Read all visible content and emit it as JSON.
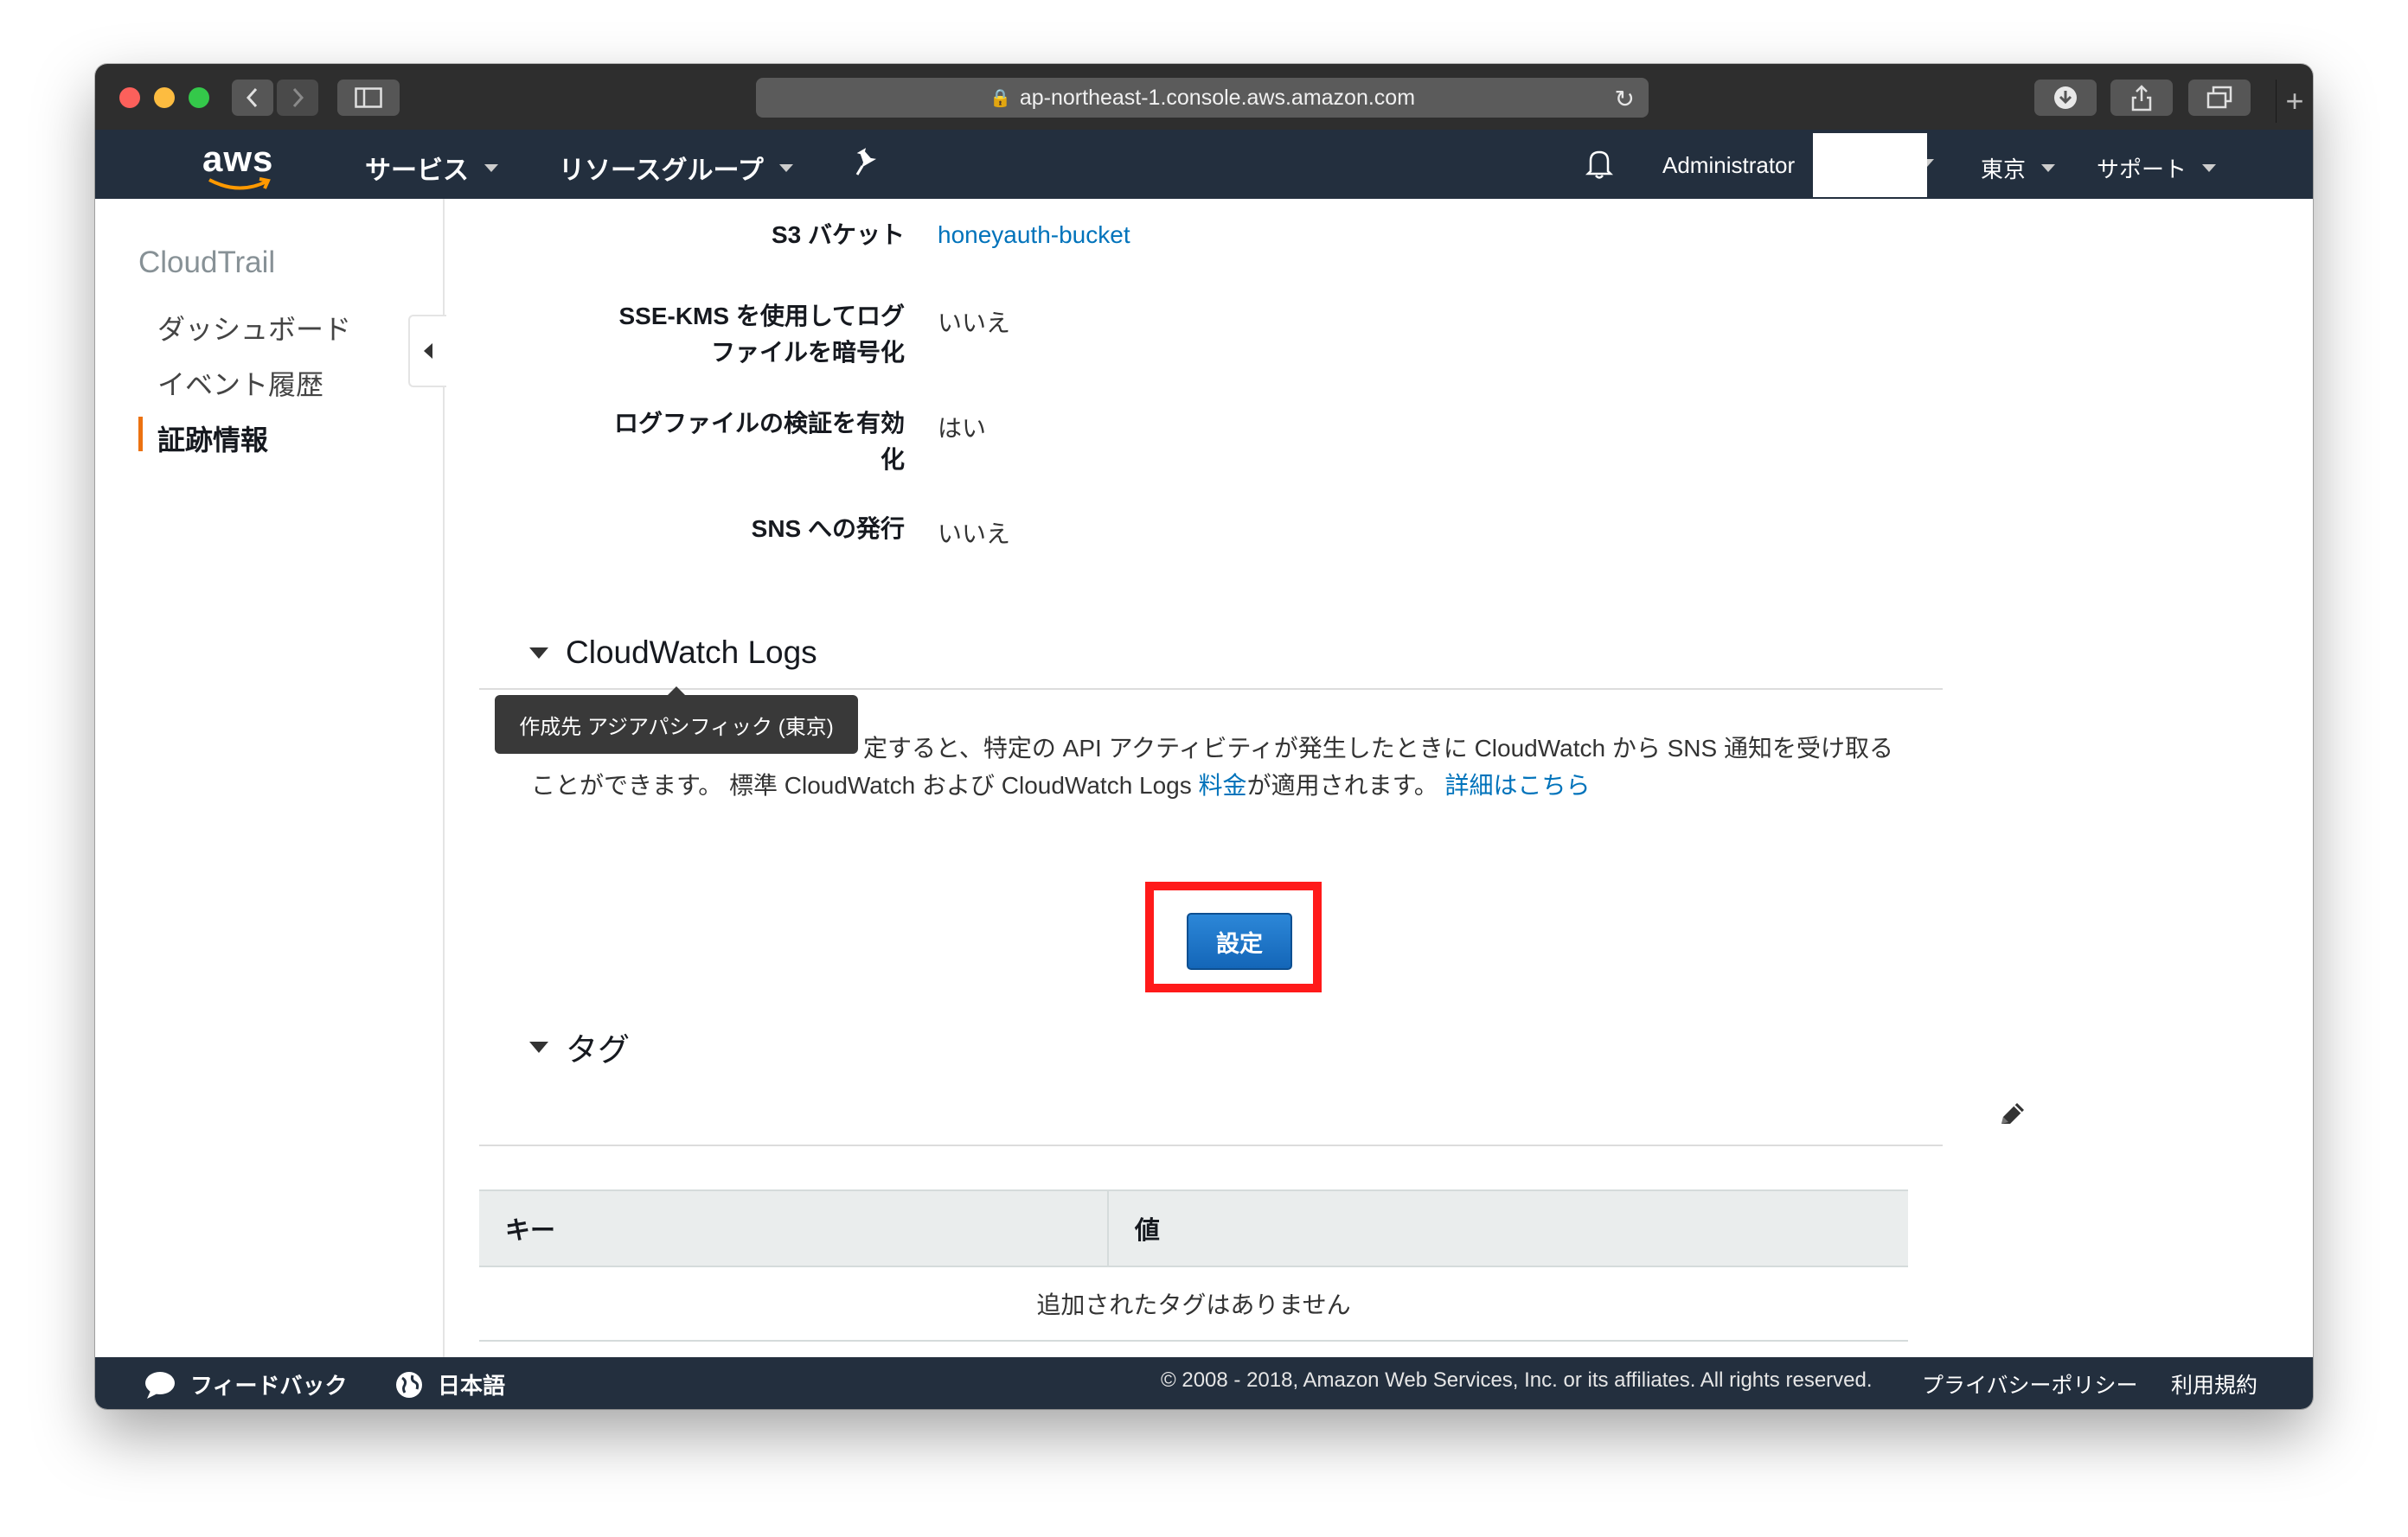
{
  "browser": {
    "url": "ap-northeast-1.console.aws.amazon.com",
    "icons": [
      "back-icon",
      "forward-icon",
      "sidebar-icon",
      "lock-icon",
      "reload-icon",
      "download-icon",
      "share-icon",
      "tabs-icon",
      "new-tab-icon"
    ]
  },
  "nav": {
    "logo": "aws",
    "services": "サービス",
    "resource_groups": "リソースグループ",
    "user": "Administrator",
    "region": "東京",
    "support": "サポート"
  },
  "sidebar": {
    "title": "CloudTrail",
    "items": [
      {
        "label": "ダッシュボード"
      },
      {
        "label": "イベント履歴"
      },
      {
        "label": "証跡情報"
      }
    ]
  },
  "details": {
    "s3_label": "S3 バケット",
    "s3_value": "honeyauth-bucket",
    "ssekms_label_1": "SSE-KMS を使用してログ",
    "ssekms_label_2": "ファイルを暗号化",
    "ssekms_value": "いいえ",
    "validation_label_1": "ログファイルの検証を有効",
    "validation_label_2": "化",
    "validation_value": "はい",
    "sns_label": "SNS への発行",
    "sns_value": "いいえ"
  },
  "cloudwatch": {
    "heading": "CloudWatch Logs",
    "tooltip": "作成先 アジアパシフィック (東京)",
    "desc_line1": "定すると、特定の API アクティビティが発生したときに CloudWatch から SNS 通知を受け取る",
    "desc_line2a": "ことができます。 標準 CloudWatch および CloudWatch Logs ",
    "desc_link1": "料金",
    "desc_line2b": "が適用されます。 ",
    "desc_link2": "詳細はこちら",
    "button": "設定"
  },
  "tags": {
    "heading": "タグ",
    "col_key": "キー",
    "col_value": "値",
    "empty": "追加されたタグはありません"
  },
  "footer": {
    "feedback": "フィードバック",
    "language": "日本語",
    "copyright": "© 2008 - 2018, Amazon Web Services, Inc. or its affiliates. All rights reserved.",
    "privacy": "プライバシーポリシー",
    "terms": "利用規約"
  }
}
